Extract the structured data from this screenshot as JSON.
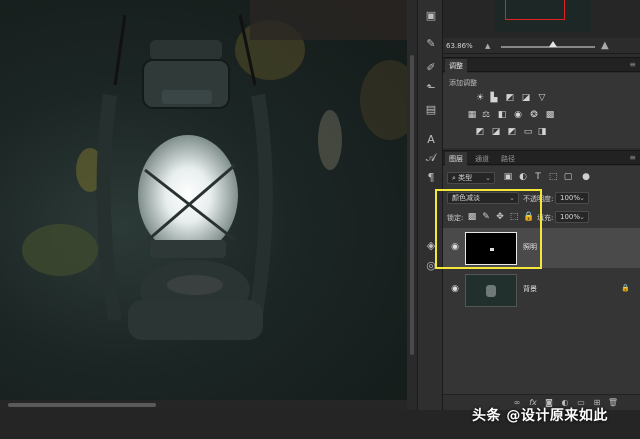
{
  "navigator": {
    "zoom": "63.86%"
  },
  "adjustments": {
    "tab": "调整",
    "add_label": "添加调整",
    "row1": [
      "brightness-icon",
      "levels-icon",
      "curves-icon",
      "exposure-icon",
      "vibrance-icon"
    ],
    "row2": [
      "hue-saturation-icon",
      "color-balance-icon",
      "black-white-icon",
      "photo-filter-icon",
      "channel-mixer-icon",
      "color-lookup-icon"
    ],
    "row3": [
      "invert-icon",
      "posterize-icon",
      "threshold-icon",
      "gradient-map-icon",
      "selective-color-icon"
    ]
  },
  "layers_panel": {
    "tabs": [
      "图层",
      "通道",
      "路径"
    ],
    "filter_kind": "类型",
    "blend_mode": "颜色减淡",
    "opacity_label": "不透明度:",
    "opacity_value": "100%",
    "lock_label": "锁定:",
    "fill_label": "填充:",
    "fill_value": "100%",
    "layers": [
      {
        "name": "照明",
        "visible": true,
        "selected": true,
        "locked": false
      },
      {
        "name": "背景",
        "visible": true,
        "selected": false,
        "locked": true
      }
    ],
    "bottom_icons": [
      "link-icon",
      "fx-icon",
      "mask-icon",
      "adjustment-layer-icon",
      "group-folder-icon",
      "new-layer-icon",
      "trash-icon"
    ]
  },
  "tools": [
    "history-icon",
    "brush-preset-icon",
    "tool-preset-icon",
    "brush-icon",
    "paragraph-style-icon",
    "character-icon",
    "glyph-icon",
    "paragraph-icon",
    "3d-icon"
  ],
  "watermark": "头条 @设计原来如此",
  "colors": {
    "highlight": "#f5e63c",
    "panel_bg": "#353535",
    "canvas_bg": "#1b2523"
  }
}
